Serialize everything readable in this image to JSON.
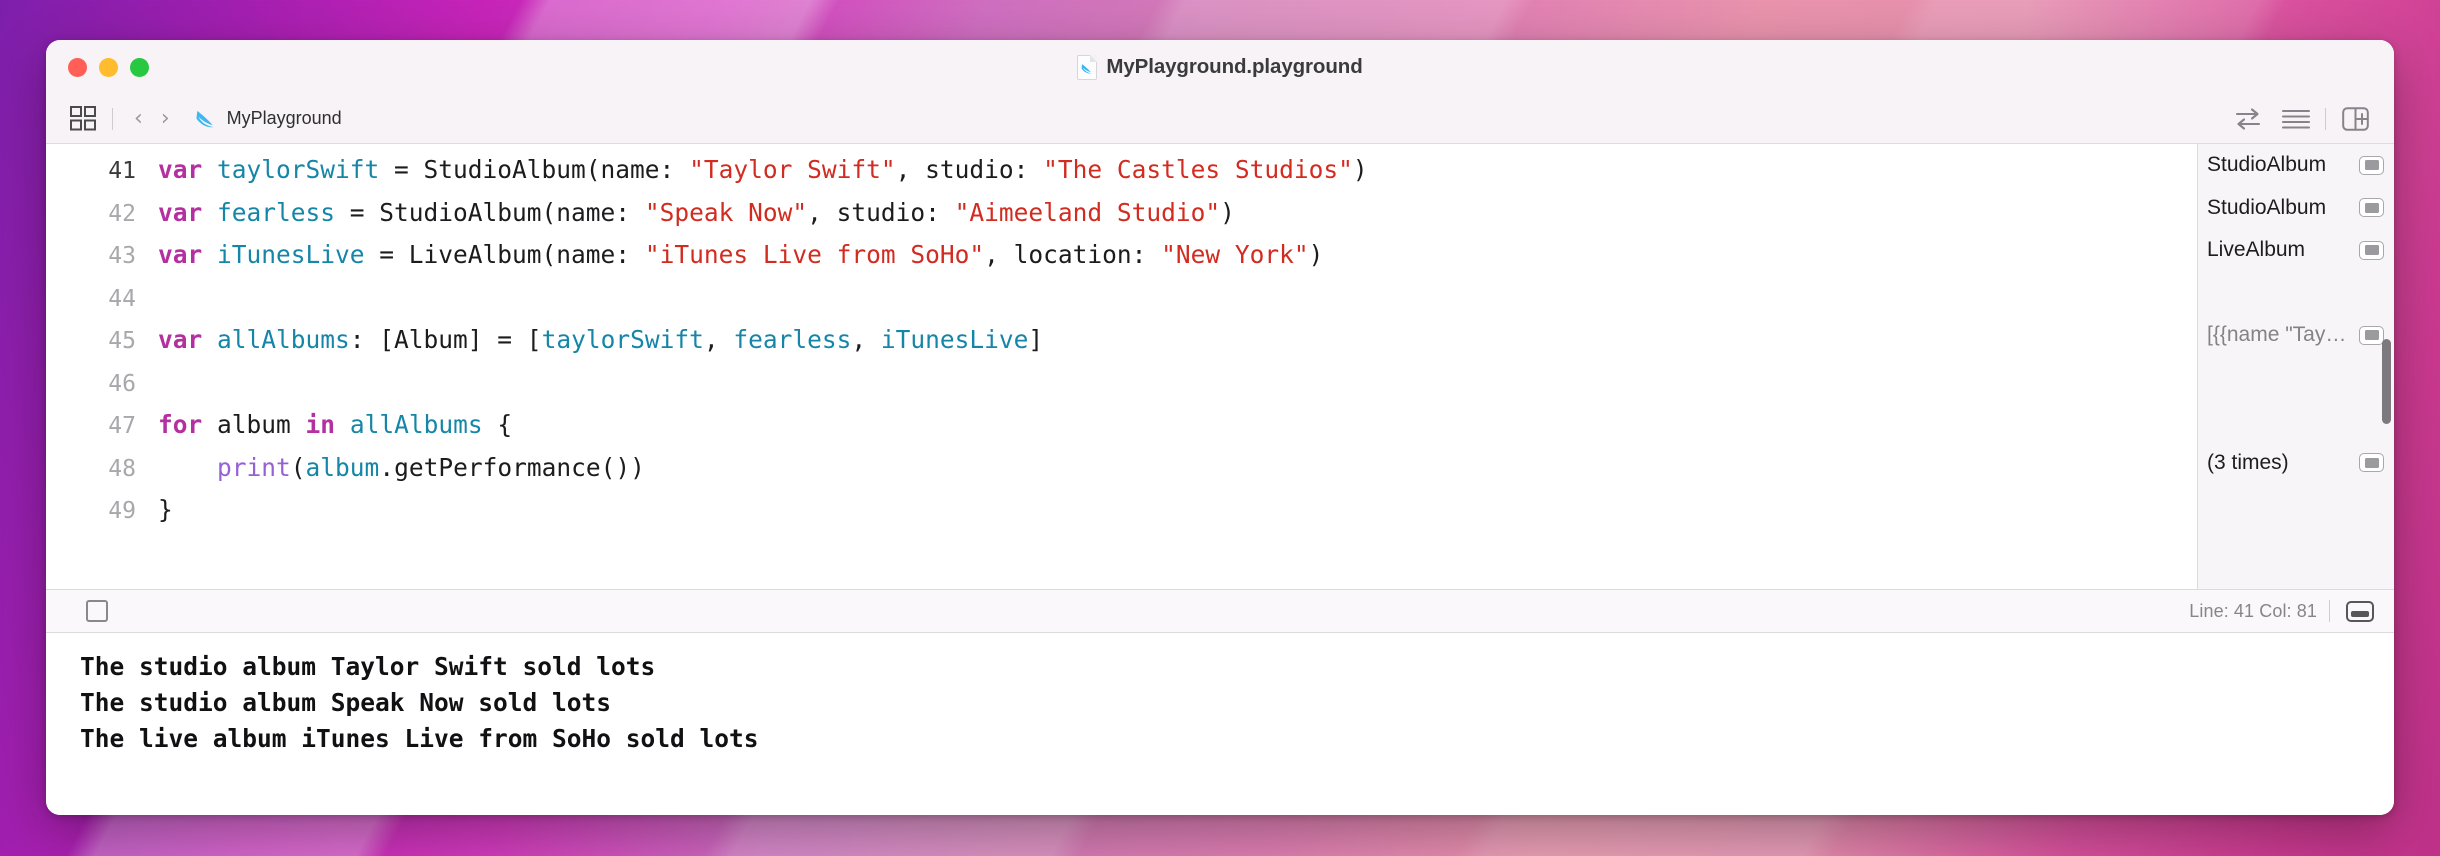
{
  "window": {
    "title": "MyPlayground.playground",
    "title_icon": "swift-playground-document-icon",
    "traffic_lights": {
      "close": "close-window-button",
      "minimize": "minimize-window-button",
      "zoom": "zoom-window-button"
    }
  },
  "toolbar": {
    "navigator_toggle": "navigator-toggle-icon",
    "back": "‹",
    "forward": "›",
    "breadcrumb": "MyPlayground",
    "breadcrumb_icon": "swift-bird-icon",
    "right_icons": [
      {
        "name": "compare-versions-icon",
        "glyph": "⇄"
      },
      {
        "name": "editor-options-icon",
        "glyph": "≡"
      },
      {
        "name": "add-editor-icon",
        "glyph": "⊞"
      }
    ]
  },
  "editor": {
    "lines": [
      {
        "number": "41",
        "current": true,
        "tokens": [
          {
            "t": "var",
            "c": "kw"
          },
          {
            "t": " ",
            "c": "pln"
          },
          {
            "t": "taylorSwift",
            "c": "ident"
          },
          {
            "t": " = StudioAlbum(name: ",
            "c": "pln"
          },
          {
            "t": "\"Taylor Swift\"",
            "c": "str"
          },
          {
            "t": ", studio: ",
            "c": "pln"
          },
          {
            "t": "\"The Castles Studios\"",
            "c": "str"
          },
          {
            "t": ")",
            "c": "pln"
          }
        ]
      },
      {
        "number": "42",
        "current": false,
        "tokens": [
          {
            "t": "var",
            "c": "kw"
          },
          {
            "t": " ",
            "c": "pln"
          },
          {
            "t": "fearless",
            "c": "ident"
          },
          {
            "t": " = StudioAlbum(name: ",
            "c": "pln"
          },
          {
            "t": "\"Speak Now\"",
            "c": "str"
          },
          {
            "t": ", studio: ",
            "c": "pln"
          },
          {
            "t": "\"Aimeeland Studio\"",
            "c": "str"
          },
          {
            "t": ")",
            "c": "pln"
          }
        ]
      },
      {
        "number": "43",
        "current": false,
        "tokens": [
          {
            "t": "var",
            "c": "kw"
          },
          {
            "t": " ",
            "c": "pln"
          },
          {
            "t": "iTunesLive",
            "c": "ident"
          },
          {
            "t": " = LiveAlbum(name: ",
            "c": "pln"
          },
          {
            "t": "\"iTunes Live from SoHo\"",
            "c": "str"
          },
          {
            "t": ", location: ",
            "c": "pln"
          },
          {
            "t": "\"New York\"",
            "c": "str"
          },
          {
            "t": ")",
            "c": "pln"
          }
        ]
      },
      {
        "number": "44",
        "current": false,
        "tokens": []
      },
      {
        "number": "45",
        "current": false,
        "tokens": [
          {
            "t": "var",
            "c": "kw"
          },
          {
            "t": " ",
            "c": "pln"
          },
          {
            "t": "allAlbums",
            "c": "ident"
          },
          {
            "t": ": [Album] = [",
            "c": "pln"
          },
          {
            "t": "taylorSwift",
            "c": "ident"
          },
          {
            "t": ", ",
            "c": "pln"
          },
          {
            "t": "fearless",
            "c": "ident"
          },
          {
            "t": ", ",
            "c": "pln"
          },
          {
            "t": "iTunesLive",
            "c": "ident"
          },
          {
            "t": "]",
            "c": "pln"
          }
        ]
      },
      {
        "number": "46",
        "current": false,
        "tokens": []
      },
      {
        "number": "47",
        "current": false,
        "tokens": [
          {
            "t": "for",
            "c": "kw"
          },
          {
            "t": " album ",
            "c": "pln"
          },
          {
            "t": "in",
            "c": "kw"
          },
          {
            "t": " ",
            "c": "pln"
          },
          {
            "t": "allAlbums",
            "c": "ident"
          },
          {
            "t": " {",
            "c": "pln"
          }
        ]
      },
      {
        "number": "48",
        "current": false,
        "tokens": [
          {
            "t": "    ",
            "c": "pln"
          },
          {
            "t": "print",
            "c": "fn"
          },
          {
            "t": "(",
            "c": "pln"
          },
          {
            "t": "album",
            "c": "ident"
          },
          {
            "t": ".getPerformance())",
            "c": "pln"
          }
        ]
      },
      {
        "number": "49",
        "current": false,
        "tokens": [
          {
            "t": "}",
            "c": "pln"
          }
        ]
      }
    ]
  },
  "results": {
    "rows": [
      {
        "text": "StudioAlbum",
        "dim": false,
        "quicklook": true
      },
      {
        "text": "StudioAlbum",
        "dim": false,
        "quicklook": true
      },
      {
        "text": "LiveAlbum",
        "dim": false,
        "quicklook": true
      },
      {
        "text": "",
        "dim": false,
        "quicklook": false
      },
      {
        "text": "[{{name \"Tay…",
        "dim": true,
        "quicklook": true
      },
      {
        "text": "",
        "dim": false,
        "quicklook": false
      },
      {
        "text": "",
        "dim": false,
        "quicklook": false
      },
      {
        "text": "(3 times)",
        "dim": false,
        "quicklook": true
      },
      {
        "text": "",
        "dim": false,
        "quicklook": false
      }
    ]
  },
  "statusbar": {
    "stop_button": "stop-execution-button",
    "line_col": "Line: 41  Col: 81",
    "panel_toggle": "toggle-debug-area-icon"
  },
  "console": {
    "lines": [
      "The studio album Taylor Swift sold lots",
      "The studio album Speak Now sold lots",
      "The live album iTunes Live from SoHo sold lots"
    ]
  },
  "colors": {
    "keyword": "#b42fa0",
    "identifier": "#1686a8",
    "string": "#d22b20",
    "function": "#9562d6",
    "plain": "#1c1c1e",
    "traffic_red": "#ff5f57",
    "traffic_yellow": "#febc2e",
    "traffic_green": "#28c840"
  }
}
